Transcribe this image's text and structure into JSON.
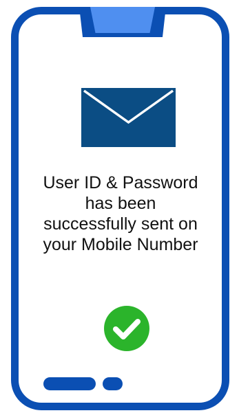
{
  "message": {
    "line1": "User ID & Password",
    "line2": "has been",
    "line3": "successfully sent on",
    "line4": "your Mobile Number"
  },
  "icons": {
    "envelope": "envelope-icon",
    "check": "check-circle-icon"
  },
  "colors": {
    "frame": "#0b4fb3",
    "notch_highlight": "#4f8ff0",
    "envelope": "#0b4d84",
    "check": "#2bb42b"
  }
}
